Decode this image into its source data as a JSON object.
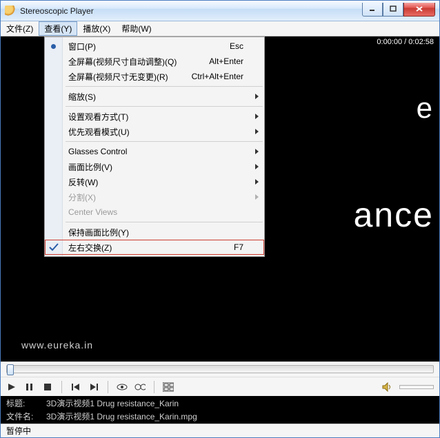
{
  "window": {
    "title": "Stereoscopic Player"
  },
  "menubar": {
    "file": "文件(Z)",
    "view": "查看(Y)",
    "play": "播放(X)",
    "help": "帮助(W)"
  },
  "dropdown": {
    "window": "窗口(P)",
    "window_shortcut": "Esc",
    "fullscreen_auto": "全屏幕(视频尺寸自动调整)(Q)",
    "fullscreen_auto_shortcut": "Alt+Enter",
    "fullscreen_fixed": "全屏幕(视频尺寸无变更)(R)",
    "fullscreen_fixed_shortcut": "Ctrl+Alt+Enter",
    "zoom": "缩放(S)",
    "viewing_method": "设置观看方式(T)",
    "preferred_mode": "优先观看模式(U)",
    "glasses": "Glasses Control",
    "aspect": "画面比例(V)",
    "flip": "反转(W)",
    "split": "分割(X)",
    "center": "Center Views",
    "keep_aspect": "保持画面比例(Y)",
    "swap_lr": "左右交换(Z)",
    "swap_lr_shortcut": "F7"
  },
  "video": {
    "text_top": "e",
    "text_mid": "ance",
    "watermark": "www.eureka.in",
    "timecode": "0:00:00 / 0:02:58"
  },
  "info": {
    "title_label": "标题:",
    "title_value": "3D演示视频1 Drug resistance_Karin",
    "file_label": "文件名:",
    "file_value": "3D演示视频1 Drug resistance_Karin.mpg"
  },
  "status": {
    "text": "暂停中"
  }
}
